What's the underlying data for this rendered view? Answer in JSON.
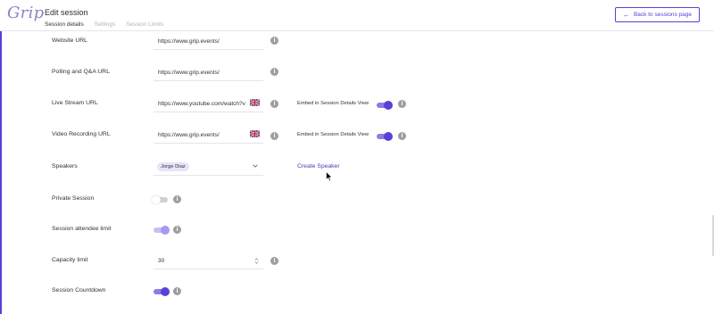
{
  "app": {
    "logo": "Grip"
  },
  "header": {
    "title": "Edit session",
    "tabs": [
      {
        "label": "Session details",
        "active": true
      },
      {
        "label": "Settings",
        "active": false
      },
      {
        "label": "Session Limits",
        "active": false
      }
    ],
    "back_button": "Back to sessions page"
  },
  "form": {
    "website_url": {
      "label": "Website URL",
      "value": "https://www.grip.events/"
    },
    "polling_url": {
      "label": "Polling and Q&A URL",
      "value": "https://www.grip.events/"
    },
    "live_stream_url": {
      "label": "Live Stream URL",
      "value": "https://www.youtube.com/watch?v",
      "embed_label": "Embed in Session Details View",
      "embed_enabled": true
    },
    "video_recording_url": {
      "label": "Video Recording URL",
      "value": "https://www.grip.events/",
      "embed_label": "Embed in Session Details View",
      "embed_enabled": true
    },
    "speakers": {
      "label": "Speakers",
      "selected": "Jorge Diaz",
      "create_link": "Create Speaker"
    },
    "private_session": {
      "label": "Private Session",
      "enabled": false
    },
    "attendee_limit": {
      "label": "Session attendee limit",
      "enabled": true
    },
    "capacity_limit": {
      "label": "Capacity limit",
      "value": "30"
    },
    "session_countdown": {
      "label": "Session Countdown",
      "enabled": true
    }
  },
  "icons": {
    "info": "info-icon",
    "flag": "uk-flag-icon",
    "chevron": "chevron-down-icon",
    "back": "arrow-left-icon"
  },
  "colors": {
    "accent": "#5b3fd6",
    "toggle_track_on": "#8d7be6",
    "chip_bg": "#e8e3fb",
    "info_icon": "#9e9e9e"
  }
}
